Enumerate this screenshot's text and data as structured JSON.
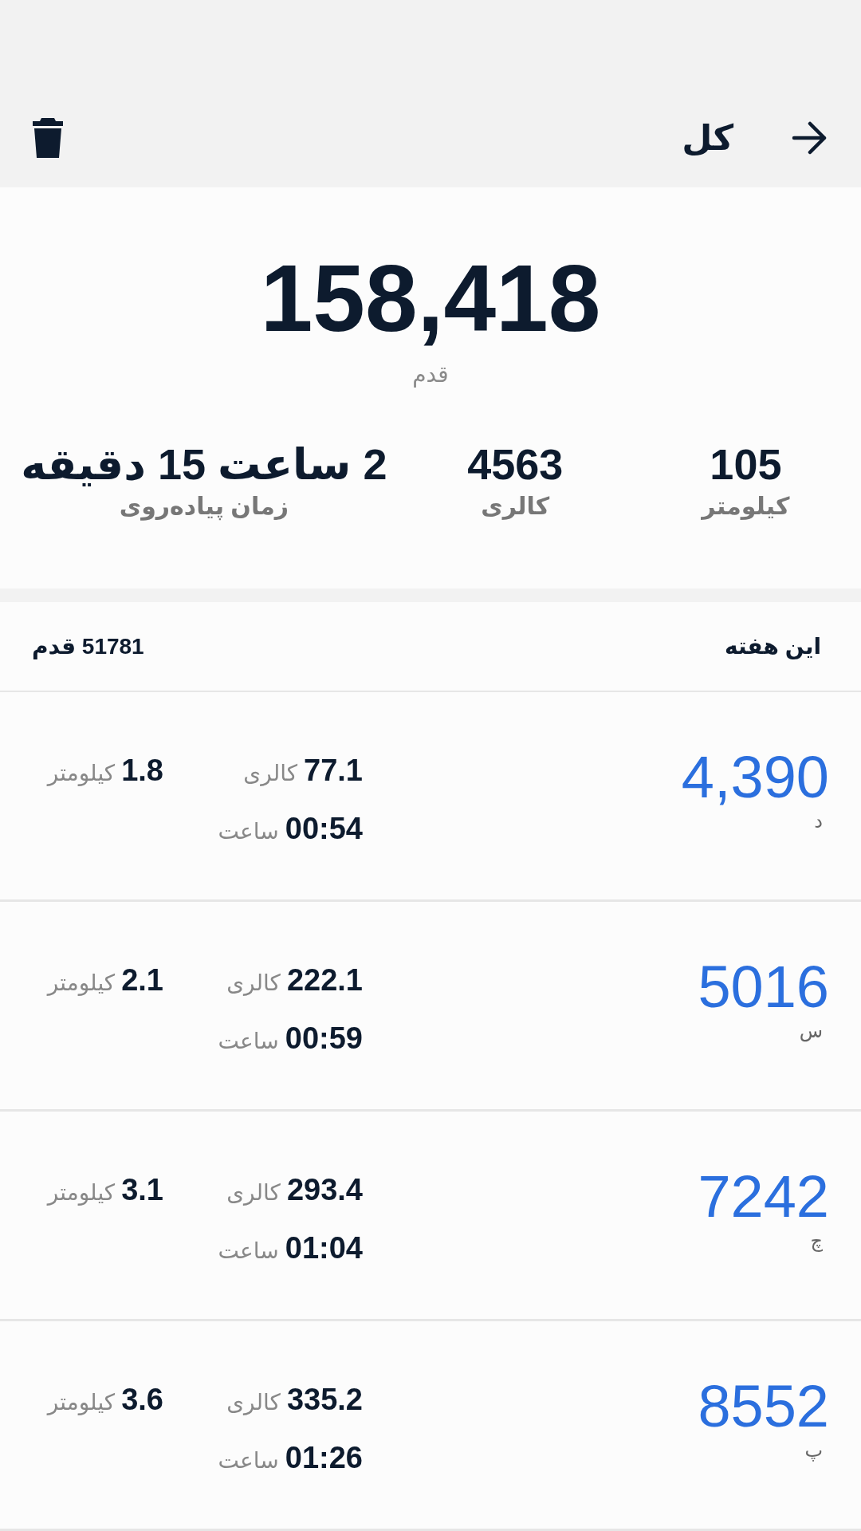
{
  "header": {
    "title": "کل"
  },
  "summary": {
    "steps": "158,418",
    "steps_unit": "قدم",
    "stats": [
      {
        "value": "105",
        "label": "کیلومتر"
      },
      {
        "value": "4563",
        "label": "کالری"
      },
      {
        "value": "2 ساعت 15 دقیقه",
        "label": "زمان پیاده‌روی"
      }
    ]
  },
  "week": {
    "title": "این هفته",
    "total": "51781",
    "total_unit": "قدم"
  },
  "days": [
    {
      "steps": "4,390",
      "day": "د",
      "calories": "77.1",
      "calories_unit": "کالری",
      "time": "00:54",
      "time_unit": "ساعت",
      "distance": "1.8",
      "distance_unit": "کیلومتر"
    },
    {
      "steps": "5016",
      "day": "س",
      "calories": "222.1",
      "calories_unit": "کالری",
      "time": "00:59",
      "time_unit": "ساعت",
      "distance": "2.1",
      "distance_unit": "کیلومتر"
    },
    {
      "steps": "7242",
      "day": "چ",
      "calories": "293.4",
      "calories_unit": "کالری",
      "time": "01:04",
      "time_unit": "ساعت",
      "distance": "3.1",
      "distance_unit": "کیلومتر"
    },
    {
      "steps": "8552",
      "day": "پ",
      "calories": "335.2",
      "calories_unit": "کالری",
      "time": "01:26",
      "time_unit": "ساعت",
      "distance": "3.6",
      "distance_unit": "کیلومتر"
    }
  ]
}
